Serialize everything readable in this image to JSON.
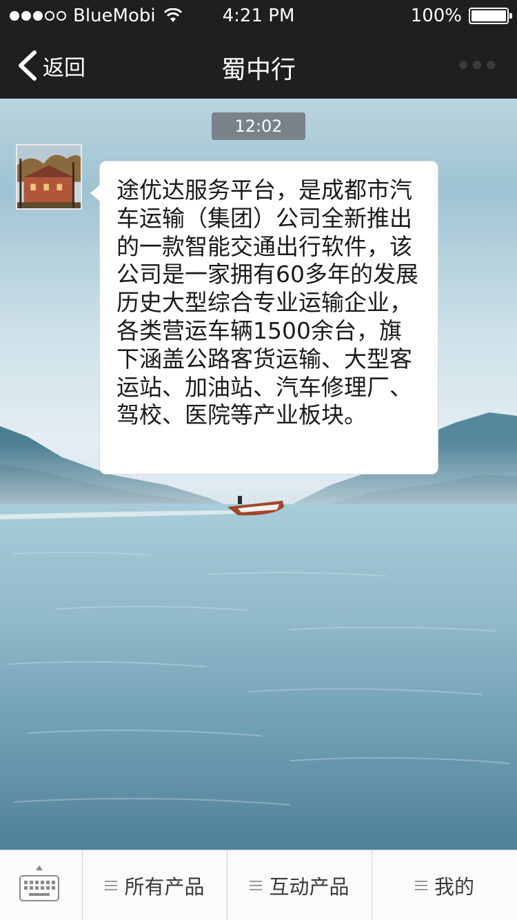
{
  "status_bar": {
    "carrier": "BlueMobi",
    "time": "4:21 PM",
    "battery": "100%",
    "signal_bars_filled": 3,
    "signal_bars_total": 5
  },
  "nav": {
    "back_label": "返回",
    "title": "蜀中行"
  },
  "chat": {
    "timestamp": "12:02",
    "message": "途优达服务平台，是成都市汽车运输（集团）公司全新推出的一款智能交通出行软件，该公司是一家拥有60多年的发展历史大型综合专业运输企业，各类营运车辆1500余台，旗下涵盖公路客货运输、大型客运站、加油站、汽车修理厂、驾校、医院等产业板块。"
  },
  "tab_bar": {
    "items": [
      {
        "label": "所有产品"
      },
      {
        "label": "互动产品"
      },
      {
        "label": "我的"
      }
    ]
  },
  "colors": {
    "bar_background": "#1f1f21",
    "bubble_background": "#ffffff",
    "tab_bar_background": "#fbfbfb"
  }
}
